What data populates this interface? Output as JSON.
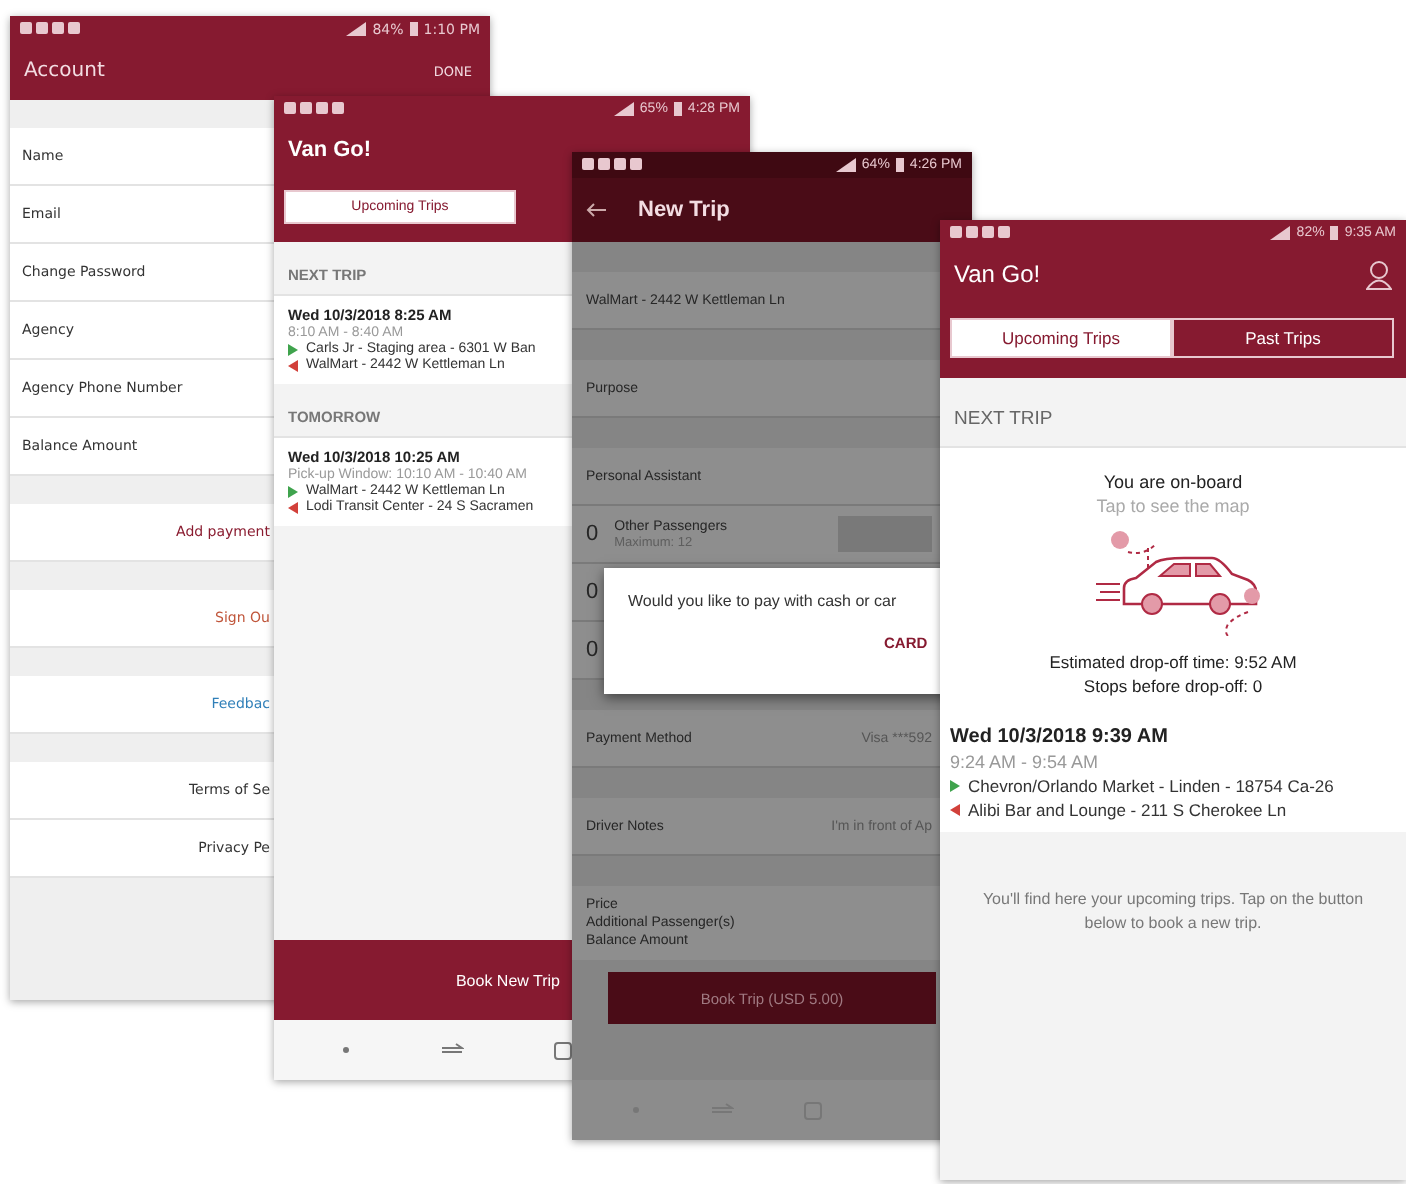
{
  "screens": [
    {
      "kind": "account",
      "status": {
        "battery": "84%",
        "time": "1:10 PM"
      },
      "title": "Account",
      "action": "DONE",
      "fields": [
        "Name",
        "Email",
        "Change Password",
        "Agency",
        "Agency Phone Number",
        "Balance Amount"
      ],
      "link_groups": [
        [
          {
            "label": "Add payment",
            "color": "#8a1c30"
          }
        ],
        [
          {
            "label": "Sign Ou",
            "color": "#c0553a"
          }
        ],
        [
          {
            "label": "Feedbac",
            "color": "#2f7fb8"
          }
        ],
        [
          {
            "label": "Terms of Se",
            "color": "#333333"
          },
          {
            "label": "Privacy Pe",
            "color": "#333333"
          }
        ]
      ]
    },
    {
      "kind": "trips",
      "status": {
        "battery": "65%",
        "time": "4:28 PM"
      },
      "title": "Van Go!",
      "tabs": [
        {
          "label": "Upcoming Trips",
          "selected": true
        }
      ],
      "sections": [
        {
          "heading": "NEXT TRIP",
          "trips": [
            {
              "date": "Wed 10/3/2018 8:25 AM",
              "window": "8:10 AM - 8:40 AM",
              "pickup": "Carls Jr - Staging area - 6301 W Ban",
              "dropoff": "WalMart - 2442 W Kettleman Ln"
            }
          ]
        },
        {
          "heading": "TOMORROW",
          "trips": [
            {
              "date": "Wed 10/3/2018 10:25 AM",
              "window": "Pick-up Window: 10:10 AM - 10:40 AM",
              "pickup": "WalMart - 2442 W Kettleman Ln",
              "dropoff": "Lodi Transit Center - 24 S Sacramen"
            }
          ]
        }
      ],
      "book_button": "Book New Trip"
    },
    {
      "kind": "new_trip",
      "status": {
        "battery": "64%",
        "time": "4:26 PM"
      },
      "title": "New Trip",
      "rows": [
        {
          "kind": "field",
          "label": "WalMart - 2442 W Kettleman Ln"
        },
        {
          "kind": "field",
          "label": "Purpose"
        },
        {
          "kind": "field",
          "label": "Personal Assistant"
        },
        {
          "kind": "counter",
          "count": "0",
          "label": "Other Passengers",
          "sublabel": "Maximum: 12"
        },
        {
          "kind": "counter",
          "count": "0"
        },
        {
          "kind": "counter",
          "count": "0"
        },
        {
          "kind": "field",
          "label": "Payment Method",
          "value": "Visa ***592"
        },
        {
          "kind": "field",
          "label": "Driver Notes",
          "value": "I'm in front of Ap"
        },
        {
          "kind": "price",
          "lines": [
            "Price",
            "Additional Passenger(s)",
            "Balance Amount"
          ]
        }
      ],
      "dialog": {
        "message": "Would you like to pay with cash or car",
        "action": "CARD"
      },
      "book_button": "Book Trip (USD 5.00)"
    },
    {
      "kind": "onboard",
      "status": {
        "battery": "82%",
        "time": "9:35 AM"
      },
      "title": "Van Go!",
      "tabs": [
        {
          "label": "Upcoming Trips",
          "selected": true
        },
        {
          "label": "Past Trips",
          "selected": false
        }
      ],
      "heading": "NEXT TRIP",
      "onboard": {
        "status": "You are on-board",
        "hint": "Tap to see the map",
        "eta": "Estimated drop-off time: 9:52 AM",
        "stops": "Stops before drop-off: 0"
      },
      "trip": {
        "date": "Wed 10/3/2018 9:39 AM",
        "window": "9:24 AM - 9:54 AM",
        "pickup": "Chevron/Orlando Market - Linden - 18754 Ca-26",
        "dropoff": "Alibi Bar and Lounge - 211 S Cherokee Ln"
      },
      "empty_message": "You'll find here your upcoming trips. Tap on the button below to book a new trip."
    }
  ]
}
